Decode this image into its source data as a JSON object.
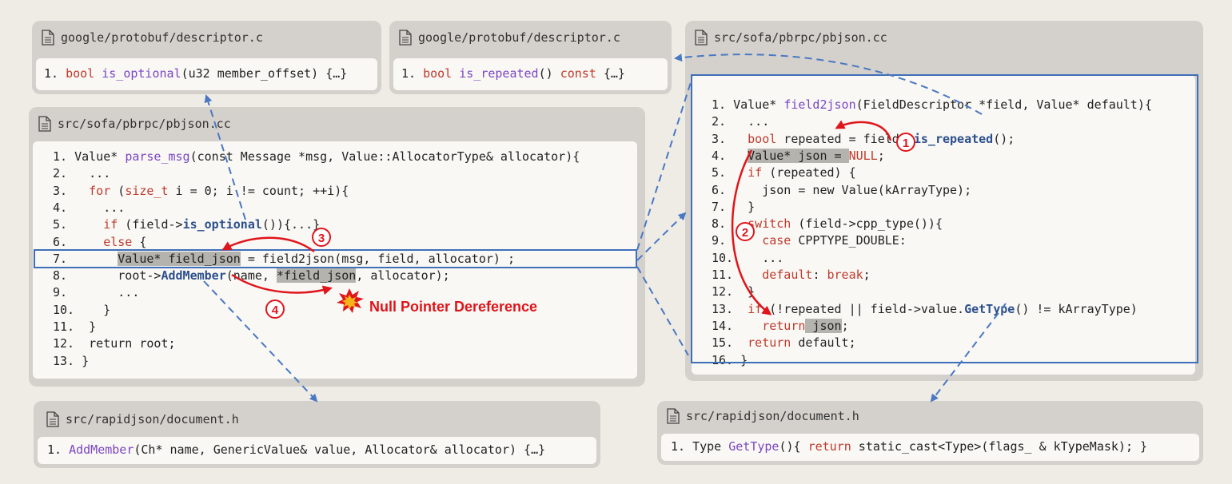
{
  "panels": {
    "desc1": {
      "title": "google/protobuf/descriptor.c"
    },
    "desc2": {
      "title": "google/protobuf/descriptor.c"
    },
    "pbjson_left": {
      "title": "src/sofa/pbrpc/pbjson.cc"
    },
    "pbjson_right": {
      "title": "src/sofa/pbrpc/pbjson.cc"
    },
    "doc1": {
      "title": "src/rapidjson/document.h"
    },
    "doc2": {
      "title": "src/rapidjson/document.h"
    }
  },
  "code": {
    "desc1": [
      [
        [
          "1. ",
          ""
        ],
        [
          "bool ",
          "kw"
        ],
        [
          "is_optional",
          "fn"
        ],
        [
          "(u32 member_offset) {…}",
          ""
        ]
      ]
    ],
    "desc2": [
      [
        [
          "1. ",
          ""
        ],
        [
          "bool ",
          "kw"
        ],
        [
          "is_repeated",
          "fn"
        ],
        [
          "() ",
          ""
        ],
        [
          "const",
          "kw"
        ],
        [
          " {…}",
          ""
        ]
      ]
    ],
    "left": [
      [
        [
          "1. Value* ",
          ""
        ],
        [
          "parse_msg",
          "fn"
        ],
        [
          "(const Message *msg, Value::AllocatorType& allocator){",
          ""
        ]
      ],
      [
        [
          "2.   ...",
          ""
        ]
      ],
      [
        [
          "3.   ",
          ""
        ],
        [
          "for",
          "kw"
        ],
        [
          " (",
          ""
        ],
        [
          "size_t",
          "kw"
        ],
        [
          " i = 0; i != count; ++i){",
          ""
        ]
      ],
      [
        [
          "4.     ...",
          ""
        ]
      ],
      [
        [
          "5.     ",
          ""
        ],
        [
          "if",
          "kw"
        ],
        [
          " (field->",
          ""
        ],
        [
          "is_optional",
          "bl"
        ],
        [
          "()){...}",
          ""
        ]
      ],
      [
        [
          "6.     ",
          ""
        ],
        [
          "else",
          "kw"
        ],
        [
          " {",
          ""
        ]
      ],
      [
        [
          "7.       ",
          ""
        ],
        [
          "Value* field_json",
          "hl"
        ],
        [
          " = field2json(msg, field, allocator) ;",
          ""
        ]
      ],
      [
        [
          "8.       root->",
          ""
        ],
        [
          "AddMember",
          "bl"
        ],
        [
          "(name, ",
          ""
        ],
        [
          "*field_json",
          "hl"
        ],
        [
          ", allocator);",
          ""
        ]
      ],
      [
        [
          "9.       ...",
          ""
        ]
      ],
      [
        [
          "10.    }",
          ""
        ]
      ],
      [
        [
          "11.  }",
          ""
        ]
      ],
      [
        [
          "12.  return root;",
          ""
        ]
      ],
      [
        [
          "13. }",
          ""
        ]
      ]
    ],
    "right": [
      [
        [
          "1. Value* ",
          ""
        ],
        [
          "field2json",
          "fn"
        ],
        [
          "(FieldDescriptor *field, Value* default){",
          ""
        ]
      ],
      [
        [
          "2.   ...",
          ""
        ]
      ],
      [
        [
          "3.   ",
          ""
        ],
        [
          "bool",
          "kw"
        ],
        [
          " repeated = field->",
          ""
        ],
        [
          "is_repeated",
          "bl"
        ],
        [
          "();",
          ""
        ]
      ],
      [
        [
          "4.   ",
          ""
        ],
        [
          "Value* json = ",
          "hl"
        ],
        [
          "NULL",
          "kw"
        ],
        [
          ";",
          ""
        ]
      ],
      [
        [
          "5.   ",
          ""
        ],
        [
          "if",
          "kw"
        ],
        [
          " (repeated) {",
          ""
        ]
      ],
      [
        [
          "6.     json = new Value(kArrayType);",
          ""
        ]
      ],
      [
        [
          "7.   }",
          ""
        ]
      ],
      [
        [
          "8.   ",
          ""
        ],
        [
          "switch",
          "kw"
        ],
        [
          " (field->cpp_type()){",
          ""
        ]
      ],
      [
        [
          "9.     ",
          ""
        ],
        [
          "case",
          "kw"
        ],
        [
          " CPPTYPE_DOUBLE:",
          ""
        ]
      ],
      [
        [
          "10.    ...",
          ""
        ]
      ],
      [
        [
          "11.    ",
          ""
        ],
        [
          "default",
          "kw"
        ],
        [
          ": ",
          ""
        ],
        [
          "break",
          "kw"
        ],
        [
          ";",
          ""
        ]
      ],
      [
        [
          "12.  }",
          ""
        ]
      ],
      [
        [
          "13.  ",
          ""
        ],
        [
          "if",
          "kw"
        ],
        [
          " (!repeated || field->value.",
          ""
        ],
        [
          "GetType",
          "bl"
        ],
        [
          "() != kArrayType)",
          ""
        ]
      ],
      [
        [
          "14.    ",
          ""
        ],
        [
          "return",
          "kw"
        ],
        [
          " json",
          "hl"
        ],
        [
          ";",
          ""
        ]
      ],
      [
        [
          "15.  ",
          ""
        ],
        [
          "return",
          "kw"
        ],
        [
          " default;",
          ""
        ]
      ],
      [
        [
          "16. }",
          ""
        ]
      ]
    ],
    "doc1": [
      [
        [
          "1. ",
          ""
        ],
        [
          "AddMember",
          "fn"
        ],
        [
          "(Ch* name, GenericValue& value, Allocator& allocator) {…}",
          ""
        ]
      ]
    ],
    "doc2": [
      [
        [
          "1. Type ",
          ""
        ],
        [
          "GetType",
          "fn"
        ],
        [
          "(){ ",
          ""
        ],
        [
          "return",
          "kw"
        ],
        [
          " static_cast<Type>(flags_ & kTypeMask); }",
          ""
        ]
      ]
    ]
  },
  "annotation": {
    "warning": "Null Pointer Dereference"
  },
  "markers": [
    "1",
    "2",
    "3",
    "4"
  ],
  "colors": {
    "arrow_red": "#e0151b",
    "dashed_blue": "#4a78c2",
    "box_blue": "#3f6fb8"
  }
}
